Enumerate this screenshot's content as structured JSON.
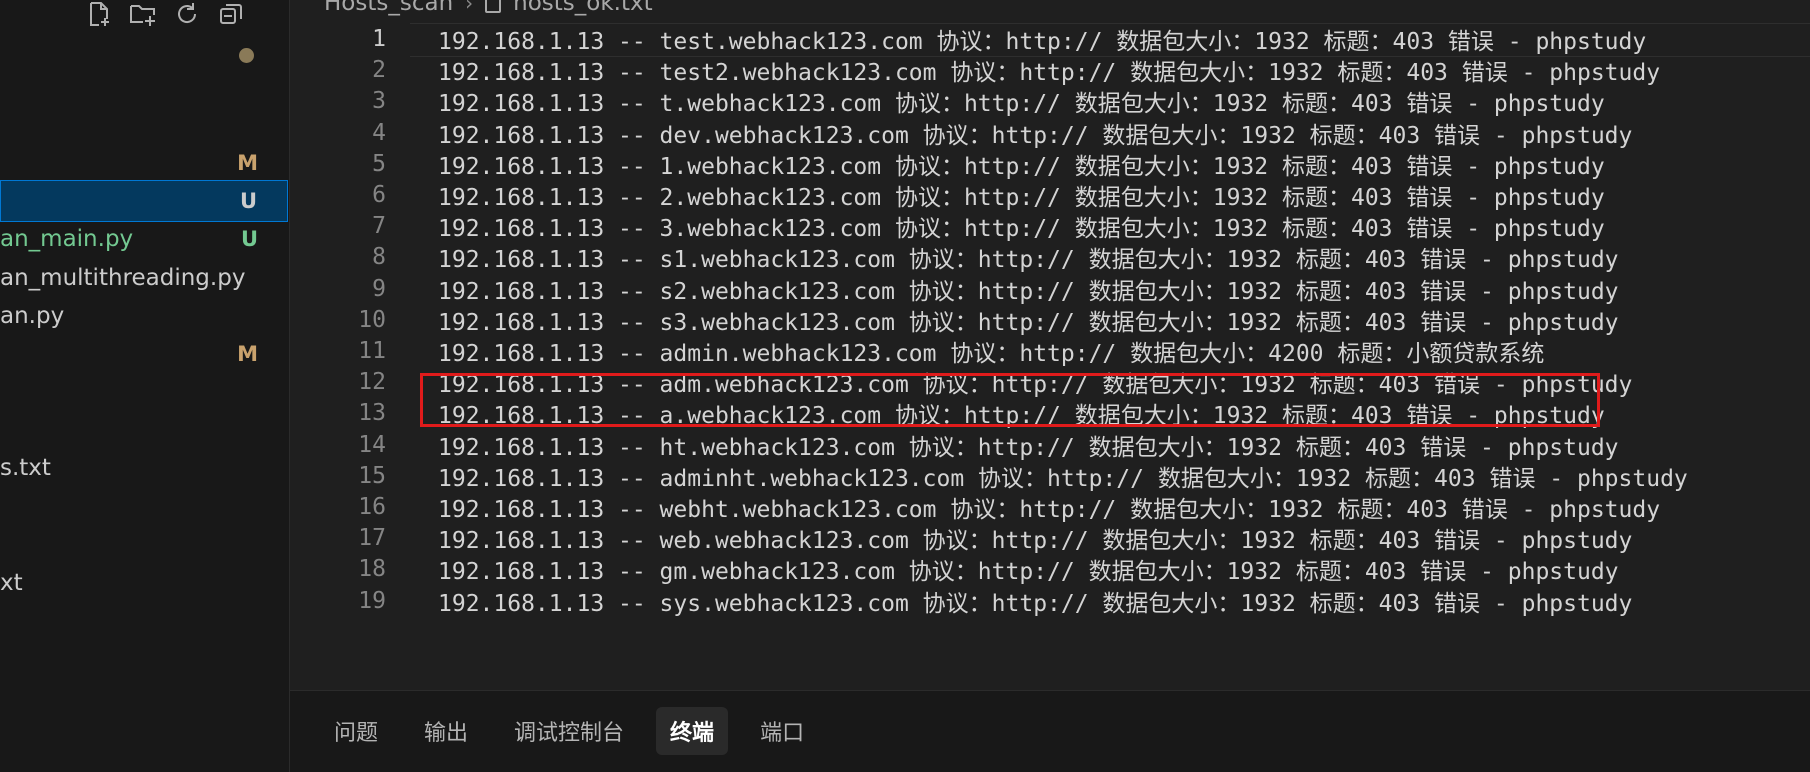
{
  "sidebar": {
    "items": [
      {
        "label": "",
        "badge": "M",
        "status": "modified"
      },
      {
        "label": "",
        "badge": "U",
        "status": "untracked",
        "selected": true
      },
      {
        "label": "an_main.py",
        "badge": "U",
        "status": "untracked"
      },
      {
        "label": "an_multithreading.py",
        "badge": "",
        "status": "normal"
      },
      {
        "label": "an.py",
        "badge": "",
        "status": "normal"
      },
      {
        "label": "",
        "badge": "M",
        "status": "modified"
      },
      {
        "label": "s.txt",
        "badge": "",
        "status": "normal"
      },
      {
        "label": "xt",
        "badge": "",
        "status": "normal"
      }
    ],
    "toolbar_icons": [
      "new-file-icon",
      "new-folder-icon",
      "refresh-icon",
      "collapse-all-icon"
    ]
  },
  "editor": {
    "breadcrumb": {
      "folder": "Hosts_scan",
      "separator": "›",
      "file": "hosts_ok.txt"
    },
    "highlight_line": 11,
    "lines": [
      {
        "num": "1",
        "text": "192.168.1.13 -- test.webhack123.com 协议：http:// 数据包大小：1932 标题：403 错误 - phpstudy"
      },
      {
        "num": "2",
        "text": "192.168.1.13 -- test2.webhack123.com 协议：http:// 数据包大小：1932 标题：403 错误 - phpstudy"
      },
      {
        "num": "3",
        "text": "192.168.1.13 -- t.webhack123.com 协议：http:// 数据包大小：1932 标题：403 错误 - phpstudy"
      },
      {
        "num": "4",
        "text": "192.168.1.13 -- dev.webhack123.com 协议：http:// 数据包大小：1932 标题：403 错误 - phpstudy"
      },
      {
        "num": "5",
        "text": "192.168.1.13 -- 1.webhack123.com 协议：http:// 数据包大小：1932 标题：403 错误 - phpstudy"
      },
      {
        "num": "6",
        "text": "192.168.1.13 -- 2.webhack123.com 协议：http:// 数据包大小：1932 标题：403 错误 - phpstudy"
      },
      {
        "num": "7",
        "text": "192.168.1.13 -- 3.webhack123.com 协议：http:// 数据包大小：1932 标题：403 错误 - phpstudy"
      },
      {
        "num": "8",
        "text": "192.168.1.13 -- s1.webhack123.com 协议：http:// 数据包大小：1932 标题：403 错误 - phpstudy"
      },
      {
        "num": "9",
        "text": "192.168.1.13 -- s2.webhack123.com 协议：http:// 数据包大小：1932 标题：403 错误 - phpstudy"
      },
      {
        "num": "10",
        "text": "192.168.1.13 -- s3.webhack123.com 协议：http:// 数据包大小：1932 标题：403 错误 - phpstudy"
      },
      {
        "num": "11",
        "text": "192.168.1.13 -- admin.webhack123.com 协议：http:// 数据包大小：4200 标题：小额贷款系统"
      },
      {
        "num": "12",
        "text": "192.168.1.13 -- adm.webhack123.com 协议：http:// 数据包大小：1932 标题：403 错误 - phpstudy"
      },
      {
        "num": "13",
        "text": "192.168.1.13 -- a.webhack123.com 协议：http:// 数据包大小：1932 标题：403 错误 - phpstudy"
      },
      {
        "num": "14",
        "text": "192.168.1.13 -- ht.webhack123.com 协议：http:// 数据包大小：1932 标题：403 错误 - phpstudy"
      },
      {
        "num": "15",
        "text": "192.168.1.13 -- adminht.webhack123.com 协议：http:// 数据包大小：1932 标题：403 错误 - phpstudy"
      },
      {
        "num": "16",
        "text": "192.168.1.13 -- webht.webhack123.com 协议：http:// 数据包大小：1932 标题：403 错误 - phpstudy"
      },
      {
        "num": "17",
        "text": "192.168.1.13 -- web.webhack123.com 协议：http:// 数据包大小：1932 标题：403 错误 - phpstudy"
      },
      {
        "num": "18",
        "text": "192.168.1.13 -- gm.webhack123.com 协议：http:// 数据包大小：1932 标题：403 错误 - phpstudy"
      },
      {
        "num": "19",
        "text": "192.168.1.13 -- sys.webhack123.com 协议：http:// 数据包大小：1932 标题：403 错误 - phpstudy"
      }
    ]
  },
  "panel": {
    "tabs": [
      {
        "label": "问题",
        "active": false
      },
      {
        "label": "输出",
        "active": false
      },
      {
        "label": "调试控制台",
        "active": false
      },
      {
        "label": "终端",
        "active": true
      },
      {
        "label": "端口",
        "active": false
      }
    ]
  },
  "colors": {
    "highlight_border": "#e01b1b",
    "selection_bg": "#04395e",
    "selection_border": "#0078d4",
    "modified_badge": "#c9a26d",
    "untracked": "#73c991"
  }
}
